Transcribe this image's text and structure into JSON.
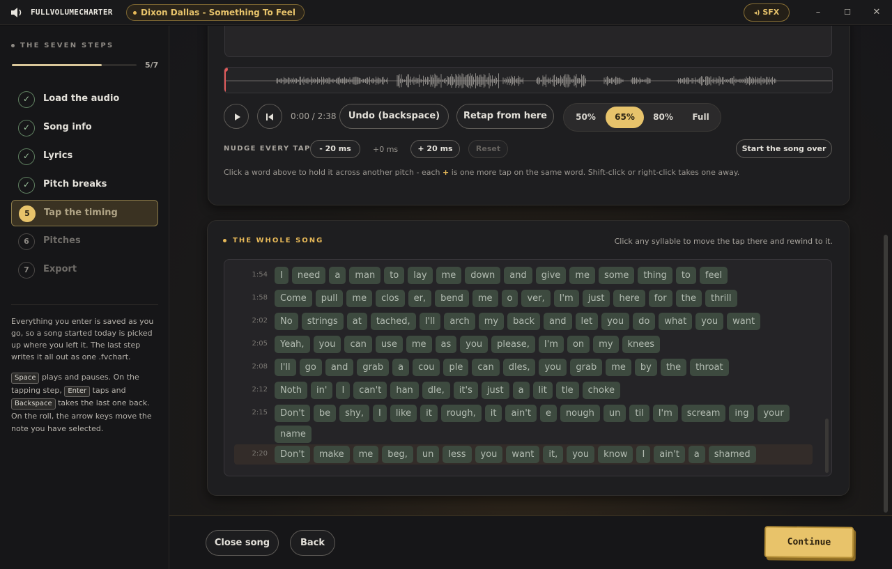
{
  "titlebar": {
    "app_name": "FULLVOLUMECHARTER",
    "song": "Dixon Dallas - Something To Feel",
    "sfx_label": "SFX",
    "minimize": "–",
    "maximize": "☐",
    "close": "✕"
  },
  "sidebar": {
    "heading": "THE SEVEN STEPS",
    "progress_count": "5/7",
    "progress_fraction": 0.72,
    "steps": [
      {
        "number": "✓",
        "label": "Load the audio",
        "state": "done"
      },
      {
        "number": "✓",
        "label": "Song info",
        "state": "done"
      },
      {
        "number": "✓",
        "label": "Lyrics",
        "state": "done"
      },
      {
        "number": "✓",
        "label": "Pitch breaks",
        "state": "done"
      },
      {
        "number": "5",
        "label": "Tap the timing",
        "state": "active"
      },
      {
        "number": "6",
        "label": "Pitches",
        "state": "todo"
      },
      {
        "number": "7",
        "label": "Export",
        "state": "todo"
      }
    ],
    "note": "Everything you enter is saved as you go, so a song started today is picked up where you left it. The last step writes it all out as one .fvchart.",
    "help": {
      "key_space": "Space",
      "t1": " plays and pauses. On the tapping step, ",
      "key_enter": "Enter",
      "t2": " taps and ",
      "key_backspace": "Backspace",
      "t3": " takes the last one back. On the roll, the arrow keys move the note you have selected."
    }
  },
  "transport": {
    "time": "0:00 / 2:38",
    "undo_label": "Undo (backspace)",
    "retap_label": "Retap from here",
    "speeds": [
      "50%",
      "65%",
      "80%",
      "Full"
    ],
    "selected_speed": "65%"
  },
  "nudge": {
    "label": "NUDGE EVERY TAP",
    "minus": "- 20 ms",
    "value": "+0 ms",
    "plus": "+ 20 ms",
    "reset": "Reset",
    "start_over": "Start the song over"
  },
  "hint": {
    "before": "Click a word above to hold it across another pitch - each ",
    "plus": "+",
    "after": " is one more tap on the same word. Shift-click or right-click takes one away."
  },
  "whole_song": {
    "heading": "THE WHOLE SONG",
    "hint": "Click any syllable to move the tap there and rewind to it.",
    "lines": [
      {
        "time": "1:54",
        "syllables": [
          "I",
          "need",
          "a",
          "man",
          "to",
          "lay",
          "me",
          "down",
          "and",
          "give",
          "me",
          "some",
          "thing",
          "to",
          "feel"
        ]
      },
      {
        "time": "1:58",
        "syllables": [
          "Come",
          "pull",
          "me",
          "clos",
          "er,",
          "bend",
          "me",
          "o",
          "ver,",
          "I'm",
          "just",
          "here",
          "for",
          "the",
          "thrill"
        ]
      },
      {
        "time": "2:02",
        "syllables": [
          "No",
          "strings",
          "at",
          "tached,",
          "I'll",
          "arch",
          "my",
          "back",
          "and",
          "let",
          "you",
          "do",
          "what",
          "you",
          "want"
        ]
      },
      {
        "time": "2:05",
        "syllables": [
          "Yeah,",
          "you",
          "can",
          "use",
          "me",
          "as",
          "you",
          "please,",
          "I'm",
          "on",
          "my",
          "knees"
        ]
      },
      {
        "time": "2:08",
        "syllables": [
          "I'll",
          "go",
          "and",
          "grab",
          "a",
          "cou",
          "ple",
          "can",
          "dles,",
          "you",
          "grab",
          "me",
          "by",
          "the",
          "throat"
        ]
      },
      {
        "time": "2:12",
        "syllables": [
          "Noth",
          "in'",
          "I",
          "can't",
          "han",
          "dle,",
          "it's",
          "just",
          "a",
          "lit",
          "tle",
          "choke"
        ]
      },
      {
        "time": "2:15",
        "syllables": [
          "Don't",
          "be",
          "shy,",
          "I",
          "like",
          "it",
          "rough,",
          "it",
          "ain't",
          "e",
          "nough",
          "un",
          "til",
          "I'm",
          "scream",
          "ing",
          "your",
          "name"
        ]
      },
      {
        "time": "2:20",
        "syllables": [
          "Don't",
          "make",
          "me",
          "beg,",
          "un",
          "less",
          "you",
          "want",
          "it,",
          "you",
          "know",
          "I",
          "ain't",
          "a",
          "shamed"
        ]
      }
    ]
  },
  "footer": {
    "close_song": "Close song",
    "back": "Back",
    "continue": "Continue"
  },
  "colors": {
    "accent": "#e7c36b",
    "syllable_bg": "#3d4a3f",
    "playhead": "#e05a5a"
  },
  "icons": {
    "speaker": "speaker-icon",
    "play": "play-icon",
    "skip_back": "skip-back-icon",
    "check": "check-icon"
  }
}
